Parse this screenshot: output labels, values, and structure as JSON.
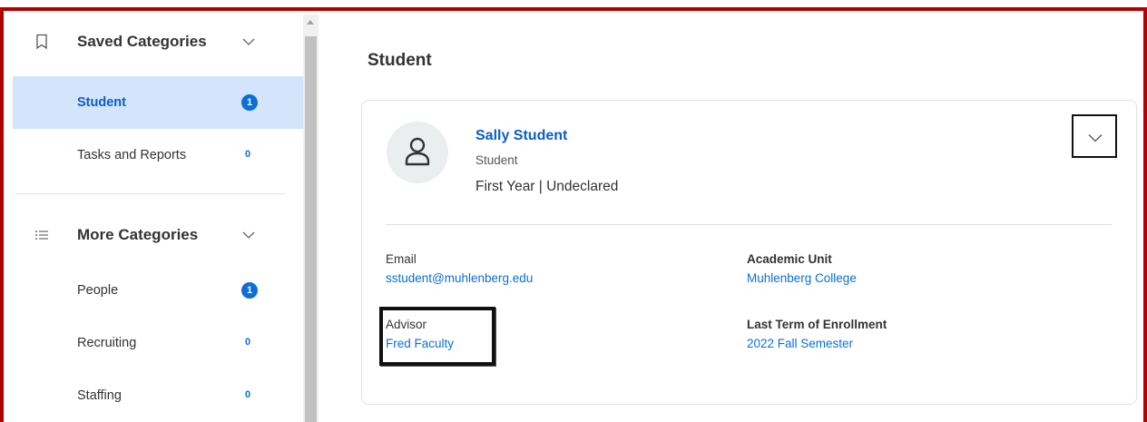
{
  "sidebar": {
    "saved": {
      "header": "Saved Categories",
      "items": [
        {
          "label": "Student",
          "count": "1",
          "active": true
        },
        {
          "label": "Tasks and Reports",
          "count": "0",
          "active": false
        }
      ]
    },
    "more": {
      "header": "More Categories",
      "items": [
        {
          "label": "People",
          "count": "1"
        },
        {
          "label": "Recruiting",
          "count": "0"
        },
        {
          "label": "Staffing",
          "count": "0"
        }
      ]
    }
  },
  "main": {
    "title": "Student",
    "card": {
      "name": "Sally Student",
      "role": "Student",
      "status": "First Year | Undeclared",
      "fields": {
        "email": {
          "label": "Email",
          "value": "sstudent@muhlenberg.edu"
        },
        "academic_unit": {
          "label": "Academic Unit",
          "value": "Muhlenberg College"
        },
        "advisor": {
          "label": "Advisor",
          "value": "Fred Faculty"
        },
        "last_term": {
          "label": "Last Term of Enrollment",
          "value": "2022 Fall Semester"
        }
      }
    }
  },
  "colors": {
    "frame_border": "#b20000",
    "active_bg": "#d3e4fb",
    "accent": "#0a6fd8",
    "link": "#0a6fd8"
  },
  "icons": {
    "saved_header": "bookmark-icon",
    "more_header": "list-icon",
    "collapse": "chevron-down-icon",
    "avatar": "user-icon"
  }
}
